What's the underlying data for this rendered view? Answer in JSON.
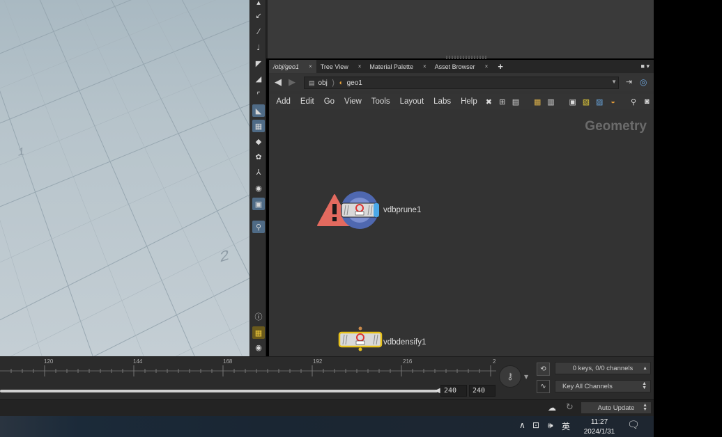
{
  "viewport": {
    "grid_labels": [
      "1",
      "2"
    ]
  },
  "network": {
    "tabs": [
      {
        "label": "/obj/geo1",
        "active": true
      },
      {
        "label": "Tree View",
        "active": false
      },
      {
        "label": "Material Palette",
        "active": false
      },
      {
        "label": "Asset Browser",
        "active": false
      }
    ],
    "tab_close": "×",
    "tab_add": "+",
    "path": [
      {
        "label": "obj",
        "icon": "obj-icon"
      },
      {
        "label": "geo1",
        "icon": "geo-icon"
      }
    ],
    "menus": [
      "Add",
      "Edit",
      "Go",
      "View",
      "Tools",
      "Layout",
      "Labs",
      "Help"
    ],
    "context_label": "Geometry",
    "nodes": [
      {
        "name": "vdbprune1",
        "state": "warning",
        "icon": "vdb-prune-node-icon"
      },
      {
        "name": "vdbdensify1",
        "state": "selected",
        "icon": "vdb-densify-node-icon"
      }
    ]
  },
  "timeline": {
    "ticks": [
      "120",
      "144",
      "168",
      "192",
      "216",
      "2"
    ],
    "end_frame": "240",
    "global_end": "240",
    "keys_status": "0 keys, 0/0 channels",
    "key_all_label": "Key All Channels"
  },
  "statusbar": {
    "update_mode": "Auto Update"
  },
  "taskbar": {
    "ime_label": "英",
    "time": "11:27",
    "date": "2024/1/31"
  },
  "colors": {
    "viewport_top": "#a9b9c2",
    "viewport_bottom": "#c4ced4",
    "network_bg": "#333333",
    "warning": "#e36a5f",
    "selected_outline": "#e8c21c",
    "active_tool": "#4f6b86"
  }
}
